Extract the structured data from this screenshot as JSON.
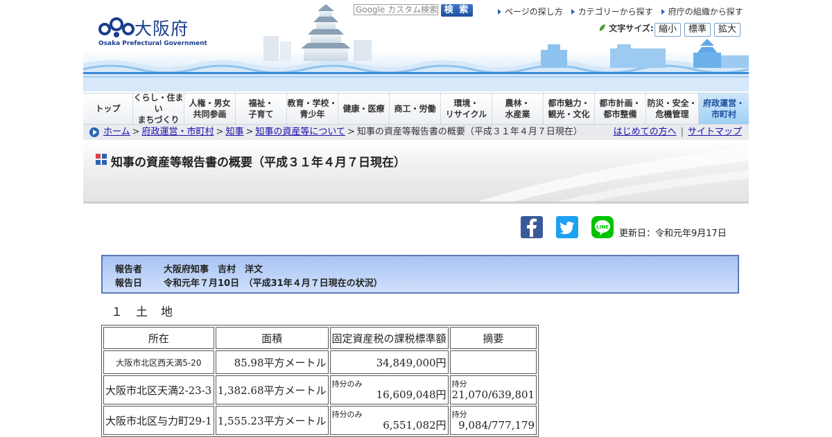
{
  "header": {
    "logo_jp": "大阪府",
    "logo_en": "Osaka Prefectural Government",
    "search_placeholder": "Google カスタム検索",
    "search_button": "検 索",
    "top_links": [
      "ページの探し方",
      "カテゴリーから探す",
      "府庁の組織から探す"
    ],
    "font_size_label": "文字サイズ:",
    "font_buttons": [
      "縮小",
      "標準",
      "拡大"
    ]
  },
  "nav": {
    "items": [
      {
        "label": "トップ"
      },
      {
        "label": "くらし・住まい\nまちづくり"
      },
      {
        "label": "人権・男女\n共同参画"
      },
      {
        "label": "福祉・\n子育て"
      },
      {
        "label": "教育・学校・\n青少年"
      },
      {
        "label": "健康・医療"
      },
      {
        "label": "商工・労働"
      },
      {
        "label": "環境・\nリサイクル"
      },
      {
        "label": "農林・\n水産業"
      },
      {
        "label": "都市魅力・\n観光・文化"
      },
      {
        "label": "都市計画・\n都市整備"
      },
      {
        "label": "防災・安全・\n危機管理"
      },
      {
        "label": "府政運営・\n市町村"
      }
    ]
  },
  "breadcrumb": {
    "links": [
      "ホーム",
      "府政運営・市町村",
      "知事",
      "知事の資産等について"
    ],
    "current": "知事の資産等報告書の概要（平成３１年４月７日現在）",
    "right_links": [
      "はじめての方へ",
      "サイトマップ"
    ]
  },
  "page": {
    "title": "知事の資産等報告書の概要（平成３１年４月７日現在）",
    "updated": "更新日：令和元年9月17日"
  },
  "reporter": {
    "label1": "報告者",
    "value1": "大阪府知事　吉村　洋文",
    "label2": "報告日",
    "value2": "令和元年７月10日　（平成31年４月７日現在の状況）"
  },
  "section_title": "１　土　地",
  "table": {
    "headers": [
      "所在",
      "面積",
      "固定資産税の課税標準額",
      "摘要"
    ],
    "rows": [
      {
        "location": "大阪市北区西天満5-20",
        "area": "85.98平方メートル",
        "tax_note": "",
        "tax": "34,849,000円",
        "note_tag": "",
        "note": ""
      },
      {
        "location": "大阪市北区天満2-23-3",
        "area": "1,382.68平方メートル",
        "tax_note": "持分のみ",
        "tax": "16,609,048円",
        "note_tag": "持分",
        "note": "21,070/639,801"
      },
      {
        "location": "大阪市北区与力町29-1",
        "area": "1,555.23平方メートル",
        "tax_note": "持分のみ",
        "tax": "6,551,082円",
        "note_tag": "持分",
        "note": "9,084/777,179"
      }
    ]
  },
  "colors": {
    "brand_blue": "#1a3e8c",
    "link": "#1a0dab",
    "facebook": "#3b5998",
    "twitter": "#1da1f2",
    "line": "#00c300"
  },
  "icons": {
    "facebook": "facebook-icon",
    "twitter": "twitter-icon",
    "line": "line-icon"
  }
}
